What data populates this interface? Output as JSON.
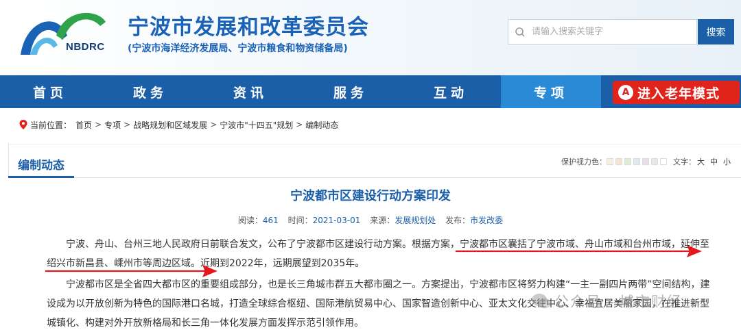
{
  "header": {
    "logo_text": "NBDRC",
    "title": "宁波市发展和改革委员会",
    "subtitle": "(宁波市海洋经济发展局、宁波市粮食和物资储备局)",
    "search_placeholder": "请输入搜索关键字",
    "search_label": "搜索"
  },
  "nav": {
    "items": [
      "首页",
      "政务",
      "资讯",
      "服务",
      "互动",
      "专项"
    ],
    "active_index": 5,
    "elder_icon": "A",
    "elder_label": "进入老年模式"
  },
  "breadcrumb": {
    "prefix": "当前位置：",
    "items": [
      "首页",
      "专项",
      "战略规划和区域发展",
      "宁波市\"十四五\"规划",
      "编制动态"
    ]
  },
  "section": {
    "tab_label": "编制动态",
    "eye_label": "保护视力色：",
    "eye_colors": [
      "#f5f0e0",
      "#f3e4d4",
      "#e2ecd4",
      "#dde8f2",
      "#e6e0ee",
      "#e8e8e8",
      "#ffffff"
    ],
    "font_label": "文字：",
    "font_sizes": [
      "大",
      "中",
      "小"
    ]
  },
  "article": {
    "title": "宁波都市区建设行动方案印发",
    "meta": {
      "reads_label": "阅读：",
      "reads": "461",
      "time_label": "时间：",
      "time": "2021-03-01",
      "source_label": "来源：",
      "source": "发展规划处",
      "publisher_label": "发布：",
      "publisher": "市发改委"
    },
    "p1": "宁波、舟山、台州三地人民政府日前联合发文，公布了宁波都市区建设行动方案。根据方案，宁波都市区囊括了宁波市域、舟山市域和台州市域，延伸至绍兴市新昌县、嵊州市等周边区域。近期到2022年，远期展望到2035年。",
    "p2": "宁波都市区是全省四大都市区的重要组成部分，也是长三角城市群五大都市圈之一。方案提出，宁波都市区将努力构建“一主一副四片两带”空间结构，建设成为以开放创新为特色的国际港口名城，打造全球综合枢纽、国际港航贸易中心、国家智造创新中心、亚太文化交往中心、幸福宜居美丽家园，在推进新型城镇化、构建对外开放新格局和长三角一体化发展方面发挥示范引领作用。"
  },
  "watermark": "公众号 · 城市财经",
  "colors": {
    "brand_blue": "#1a5fa8",
    "nav_active": "#2b8ad6",
    "elder_red": "#e0241c",
    "annotation_red": "#e8141c"
  }
}
